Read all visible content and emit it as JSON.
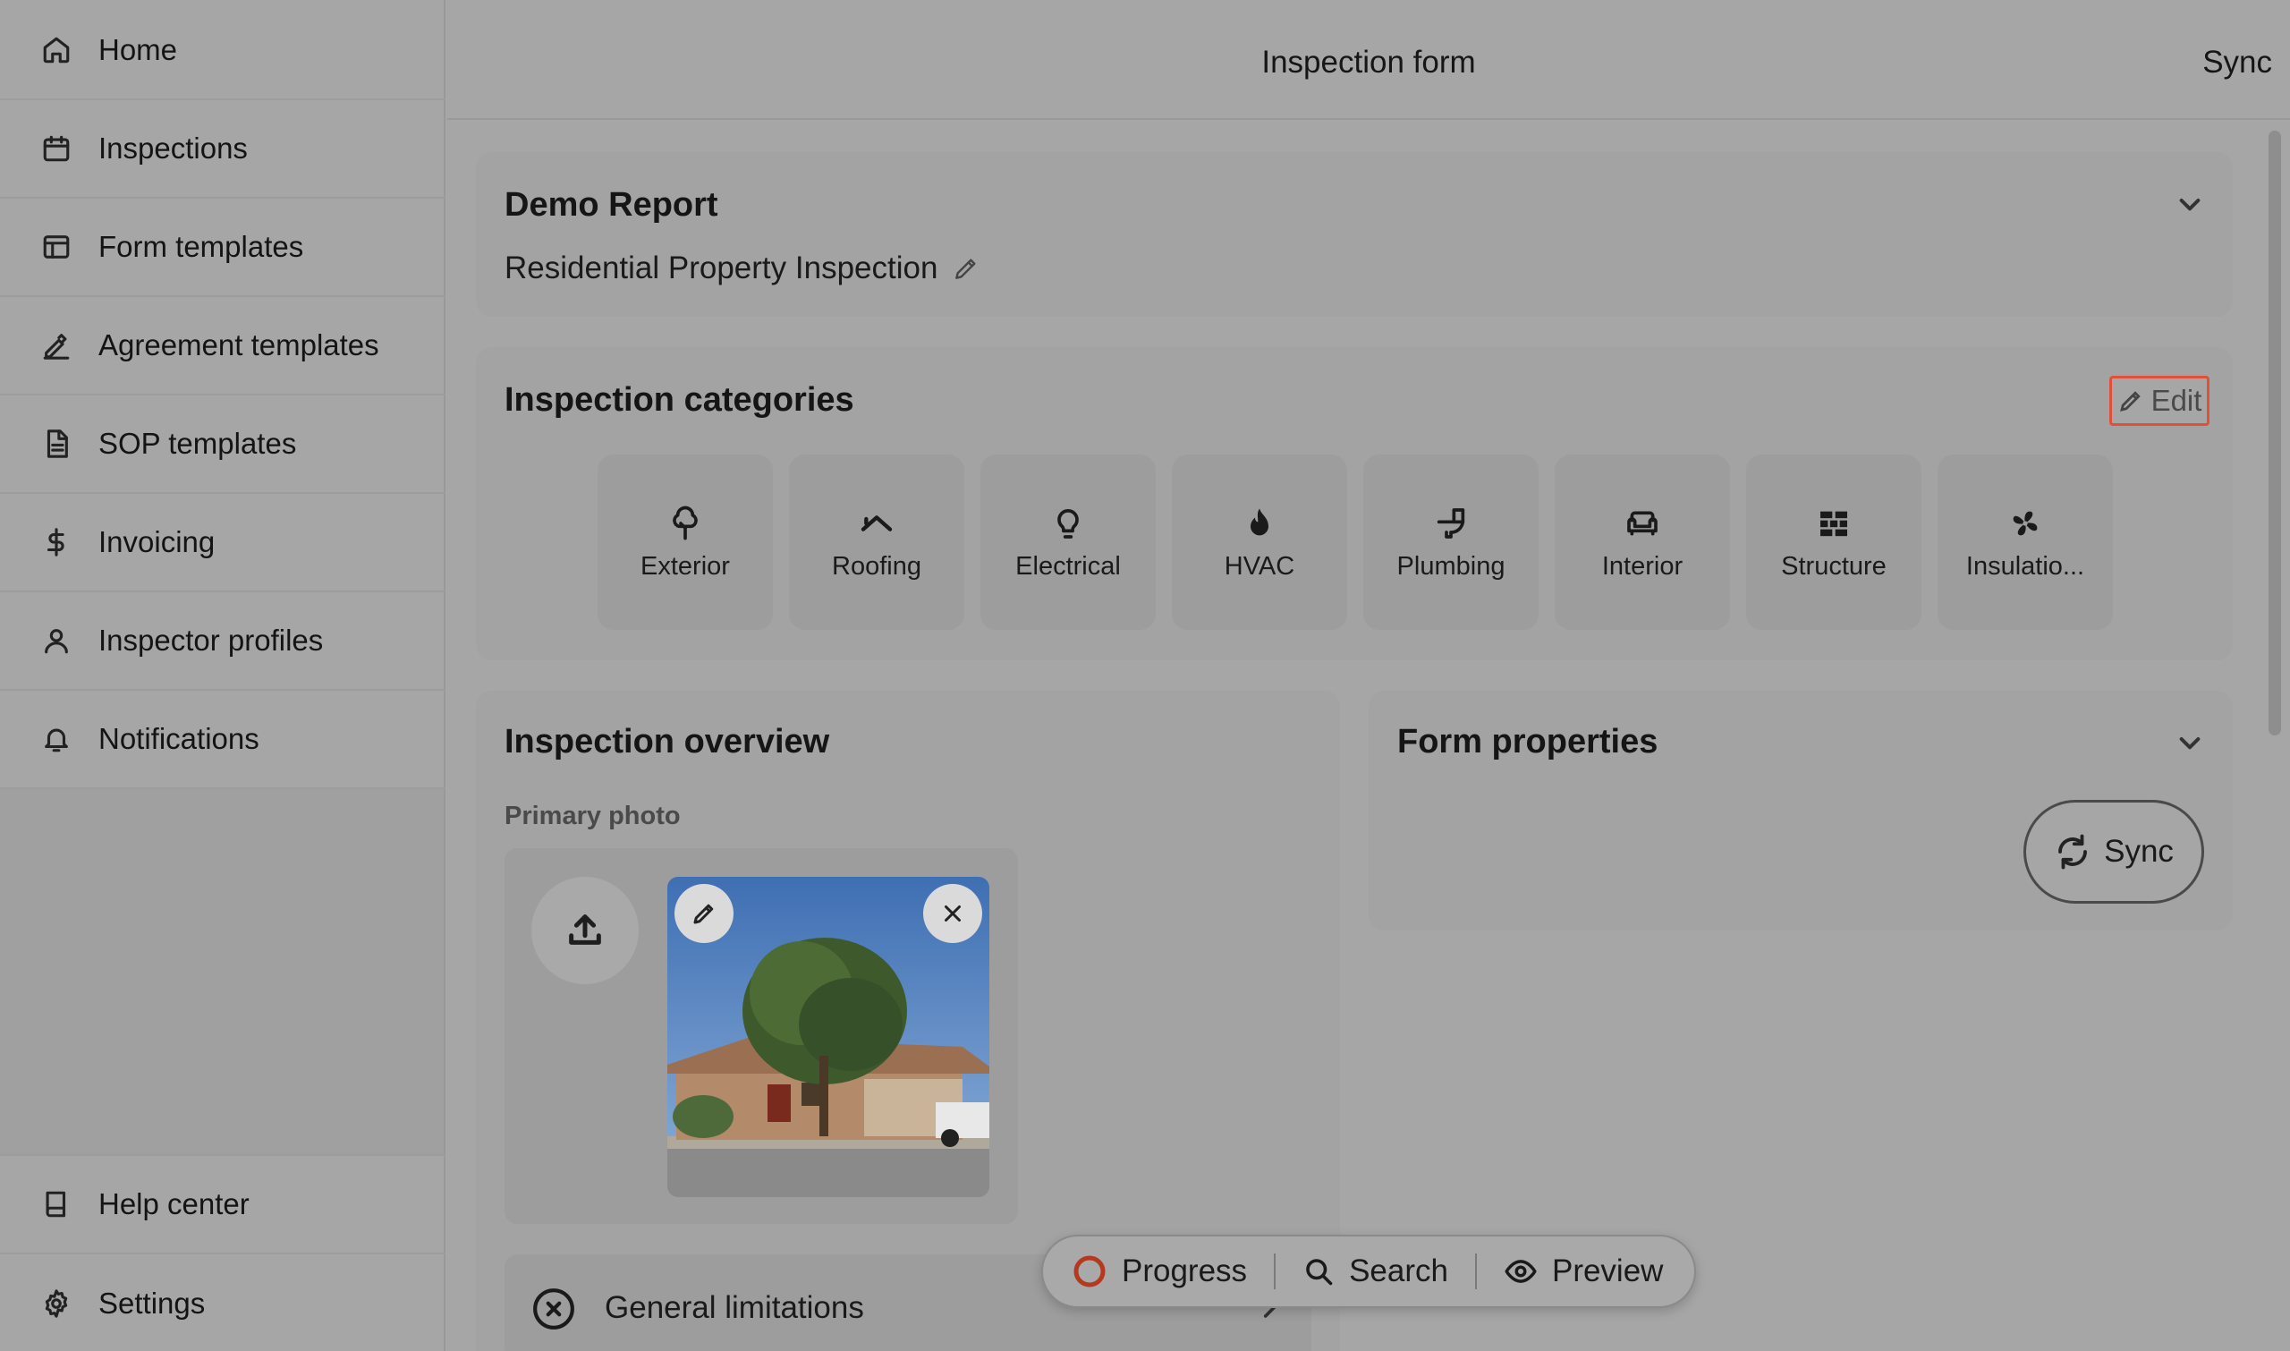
{
  "sidebar": {
    "items": [
      {
        "label": "Home",
        "icon": "home-icon"
      },
      {
        "label": "Inspections",
        "icon": "calendar-icon"
      },
      {
        "label": "Form templates",
        "icon": "layout-icon"
      },
      {
        "label": "Agreement templates",
        "icon": "signature-icon"
      },
      {
        "label": "SOP templates",
        "icon": "document-icon"
      },
      {
        "label": "Invoicing",
        "icon": "dollar-icon"
      },
      {
        "label": "Inspector profiles",
        "icon": "user-icon"
      },
      {
        "label": "Notifications",
        "icon": "bell-icon"
      }
    ],
    "bottom_items": [
      {
        "label": "Help center",
        "icon": "book-icon"
      },
      {
        "label": "Settings",
        "icon": "gear-icon"
      }
    ]
  },
  "header": {
    "title": "Inspection form",
    "sync_label": "Sync"
  },
  "report": {
    "title": "Demo Report",
    "subtitle": "Residential Property Inspection"
  },
  "categories": {
    "title": "Inspection categories",
    "edit_label": "Edit",
    "items": [
      {
        "label": "Exterior",
        "icon": "tree-icon"
      },
      {
        "label": "Roofing",
        "icon": "roof-icon"
      },
      {
        "label": "Electrical",
        "icon": "lightbulb-icon"
      },
      {
        "label": "HVAC",
        "icon": "flame-icon"
      },
      {
        "label": "Plumbing",
        "icon": "toilet-icon"
      },
      {
        "label": "Interior",
        "icon": "sofa-icon"
      },
      {
        "label": "Structure",
        "icon": "bricks-icon"
      },
      {
        "label": "Insulatio...",
        "icon": "fan-icon"
      }
    ]
  },
  "overview": {
    "title": "Inspection overview",
    "primary_photo_label": "Primary photo",
    "limitations_label": "General limitations"
  },
  "form_properties": {
    "title": "Form properties",
    "sync_label": "Sync"
  },
  "bottom_bar": {
    "progress_label": "Progress",
    "search_label": "Search",
    "preview_label": "Preview",
    "progress_color": "#b5391f"
  }
}
